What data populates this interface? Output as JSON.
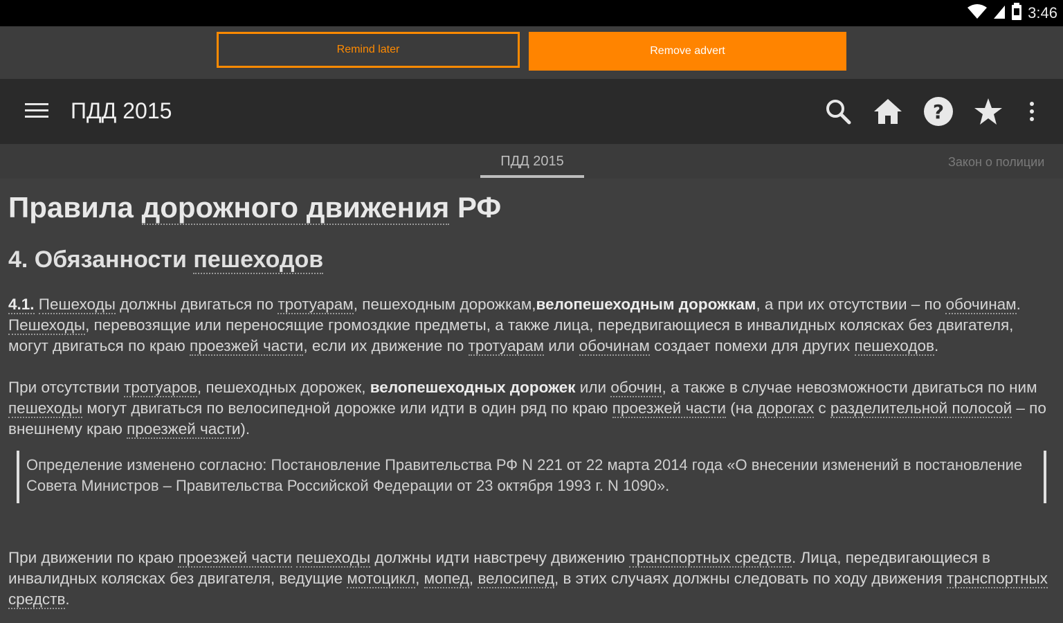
{
  "status_bar": {
    "time": "3:46",
    "icons": [
      "wifi-icon",
      "signal-icon",
      "battery-icon"
    ]
  },
  "ad_bar": {
    "remind_label": "Remind later",
    "remove_label": "Remove advert"
  },
  "toolbar": {
    "title": "ПДД 2015",
    "icons": [
      "menu-icon",
      "search-icon",
      "home-icon",
      "help-icon",
      "star-icon",
      "overflow-menu-icon"
    ]
  },
  "tabs": {
    "active": "ПДД 2015",
    "next": "Закон о полиции"
  },
  "content": {
    "page_title_a": "Правила",
    "page_title_b": "дорожного движения",
    "page_title_c": "РФ",
    "section_title_a": "4. Обязанности",
    "section_title_b": "пешеходов",
    "p1": {
      "num": "4.1.",
      "t1": "Пешеходы",
      "t2": " должны двигаться по ",
      "t3": "тротуарам",
      "t4": ", пешеходным дорожкам,",
      "t5": "велопешеходным дорожкам",
      "t6": ", а при их отсутствии – по ",
      "t7": "обочинам",
      "t8": ". ",
      "t9": "Пешеходы",
      "t10": ", перевозящие или переносящие громоздкие предметы, а также лица, передвигающиеся в инвалидных колясках без двигателя, могут двигаться по краю ",
      "t11": "проезжей части",
      "t12": ", если их движение по ",
      "t13": "тротуарам",
      "t14": " или ",
      "t15": "обочинам",
      "t16": " создает помехи для других ",
      "t17": "пешеходов",
      "t18": "."
    },
    "p2": {
      "t1": "При отсутствии ",
      "t2": "тротуаров",
      "t3": ", пешеходных дорожек, ",
      "t4": "велопешеходных дорожек",
      "t5": " или ",
      "t6": "обочин",
      "t7": ", а также в случае невозможности двигаться по ним ",
      "t8": "пешеходы",
      "t9": " могут двигаться по велосипедной дорожке или идти в один ряд по краю ",
      "t10": "проезжей части",
      "t11": " (на ",
      "t12": "дорогах",
      "t13": " с ",
      "t14": "разделительной полосой",
      "t15": " – по внешнему краю ",
      "t16": "проезжей части",
      "t17": ")."
    },
    "note": "Определение изменено согласно: Постановление Правительства РФ N 221 от 22 марта 2014 года «О внесении изменений в постановление Совета Министров – Правительства Российской Федерации от 23 октября 1993 г. N 1090».",
    "p3": {
      "t1": "При движении по краю ",
      "t2": "проезжей части",
      "t3": " ",
      "t4": "пешеходы",
      "t5": " должны идти навстречу движению ",
      "t6": "транспортных средств",
      "t7": ". Лица, передвигающиеся в инвалидных колясках без двигателя, ведущие ",
      "t8": "мотоцикл",
      "t9": ", ",
      "t10": "мопед",
      "t11": ", ",
      "t12": "велосипед",
      "t13": ", в этих случаях должны следовать по ходу движения ",
      "t14": "транспортных средств",
      "t15": "."
    }
  },
  "colors": {
    "accent": "#ff8400",
    "toolbar": "#2a2a2a",
    "background": "#3f3f3f",
    "statusbar": "#000000"
  }
}
